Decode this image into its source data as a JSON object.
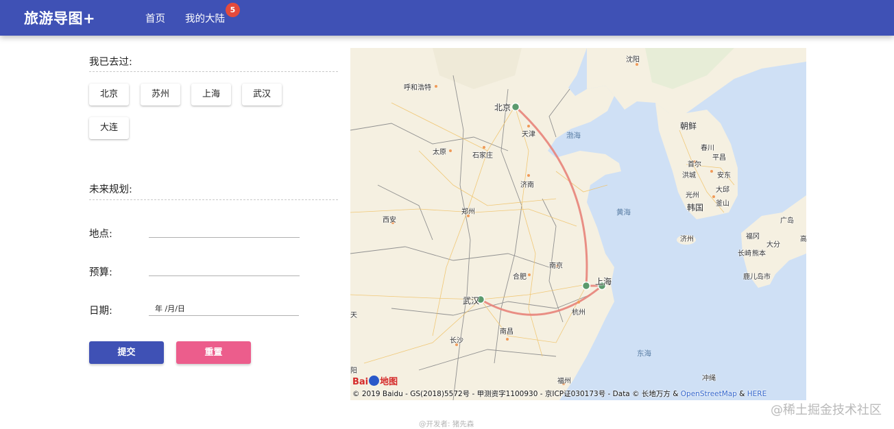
{
  "header": {
    "brand": "旅游导图+",
    "nav_home": "首页",
    "nav_continent": "我的大陆",
    "badge_count": "5",
    "bg_color": "#3f51b5"
  },
  "visited": {
    "title": "我已去过:",
    "cities": [
      "北京",
      "苏州",
      "上海",
      "武汉",
      "大连"
    ]
  },
  "plan": {
    "title": "未来规划:",
    "location_label": "地点:",
    "location_value": "",
    "budget_label": "预算:",
    "budget_value": "",
    "date_label": "日期:",
    "date_placeholder": "年 /月/日"
  },
  "buttons": {
    "submit": "提交",
    "reset": "重置",
    "submit_color": "#3f51b5",
    "reset_color": "#ec5d8c"
  },
  "map": {
    "labels": {
      "shenyang": "沈阳",
      "hohhot": "呼和浩特",
      "beijing": "北京",
      "tianjin": "天津",
      "bohai": "渤海",
      "korea_dprk": "朝鲜",
      "chunchuan": "春川",
      "seoul": "首尔",
      "pingchang": "平昌",
      "hongcheng": "洪城",
      "andong": "安东",
      "daegu": "大邱",
      "gwangju": "光州",
      "busan": "釜山",
      "korea": "韩国",
      "jeju": "济州",
      "taiyuan": "太原",
      "shijiazhuang": "石家庄",
      "jinan": "济南",
      "yellow_sea": "黄海",
      "zhengzhou": "郑州",
      "xian": "西安",
      "nanjing": "南京",
      "hefei": "合肥",
      "shanghai": "上海",
      "wuhan": "武汉",
      "hangzhou": "杭州",
      "changsha": "长沙",
      "nanchang": "南昌",
      "east_sea": "东海",
      "fuzhou": "福州",
      "fukuoka": "福冈",
      "dafen": "大分",
      "nagasaki": "长崎",
      "kumamoto": "熊本",
      "kagoshima": "鹿儿岛市",
      "hiroshima": "广岛",
      "gaokou": "高",
      "okinawa": "冲绳",
      "yang": "阳",
      "tian": "天"
    },
    "logo_text_1": "Bai",
    "logo_text_2": "地图",
    "copyright_text": "© 2019 Baidu - GS(2018)5572号 - 甲测资字1100930 - 京ICP证030173号 - Data © 长地万方 & ",
    "copyright_link1": "OpenStreetMap",
    "copyright_amp": " & ",
    "copyright_link2": "HERE",
    "route_color": "#e8837a",
    "marker_color": "#5b9a6d"
  },
  "watermark": "@稀土掘金技术社区",
  "footer": "@开发者: 猪先森"
}
